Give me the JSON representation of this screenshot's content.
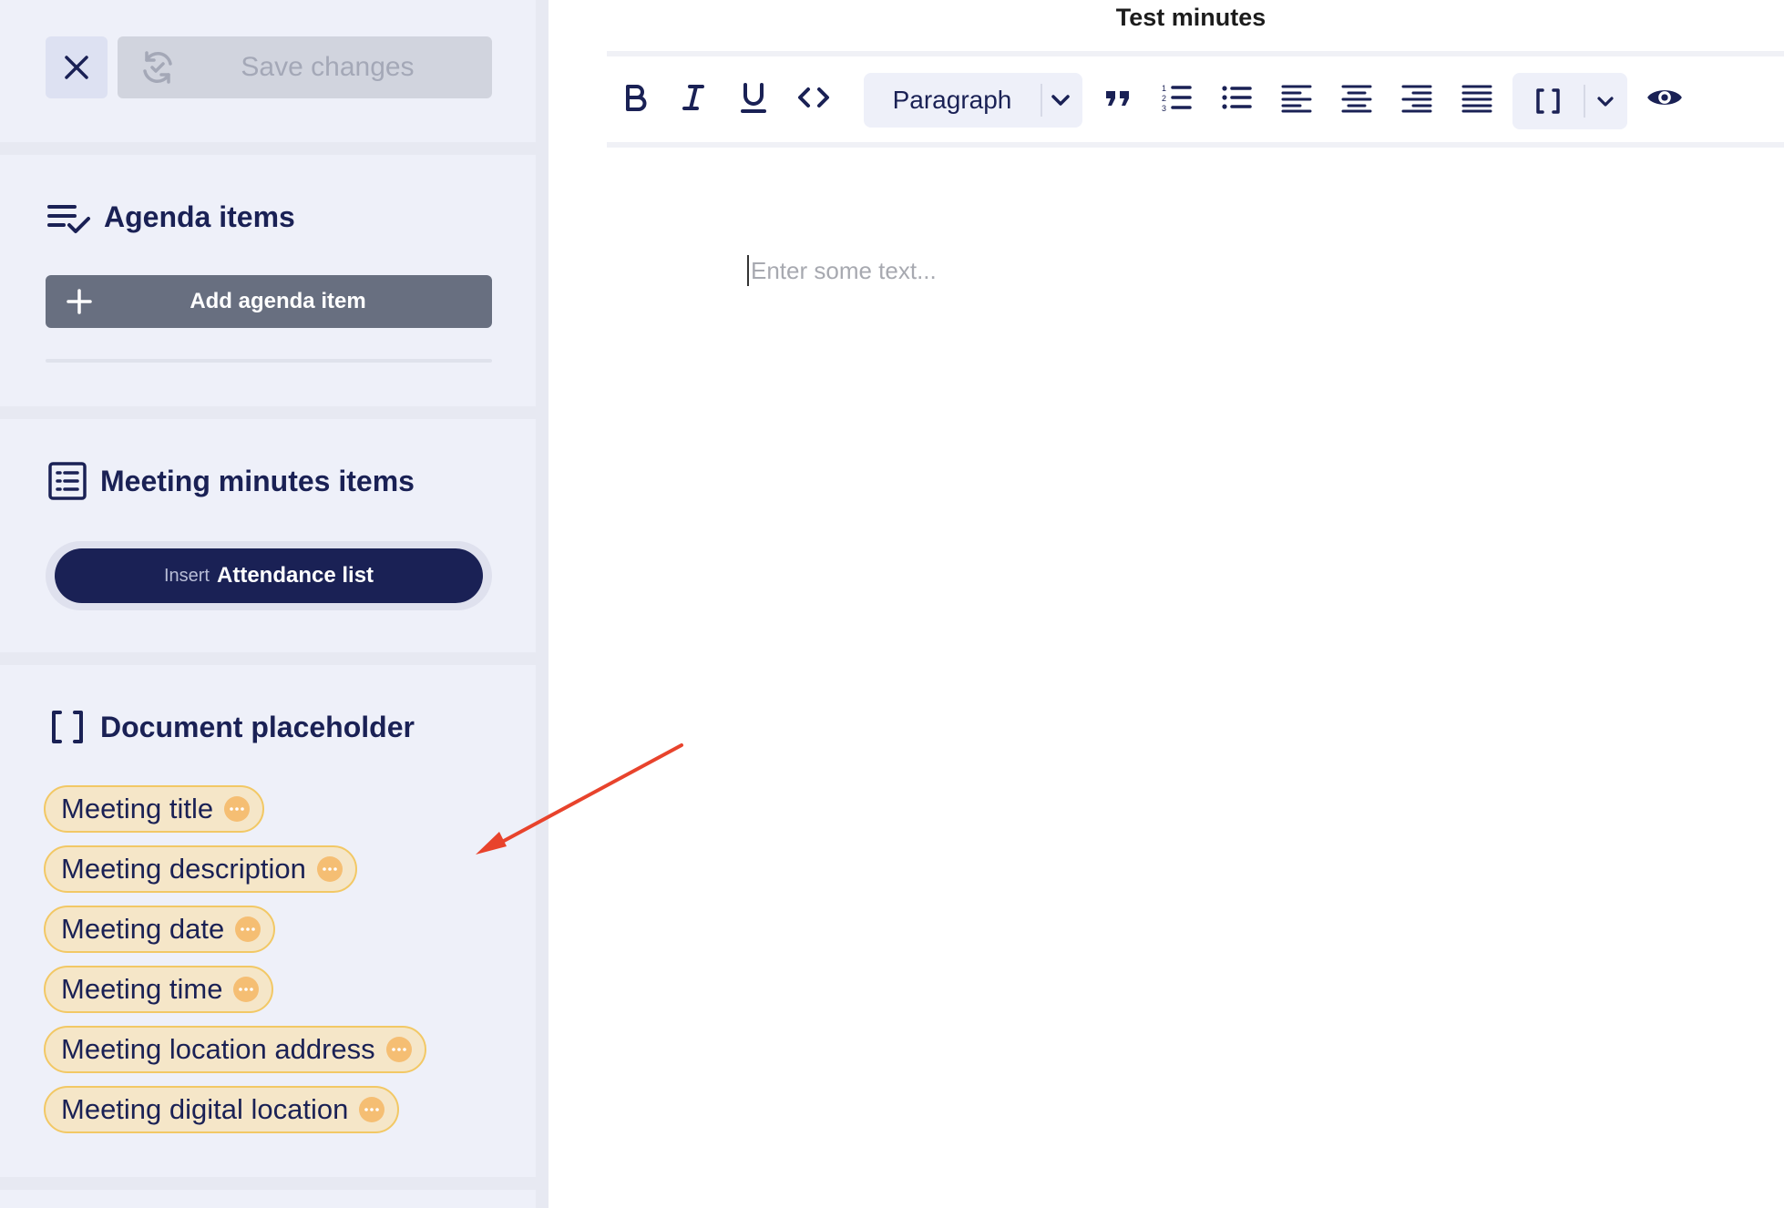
{
  "toolbar_top": {
    "close_icon": "close-icon",
    "sync_icon": "sync-icon",
    "save_label": "Save changes"
  },
  "agenda": {
    "icon": "checklist-icon",
    "heading": "Agenda items",
    "add_label": "Add agenda item"
  },
  "minutes": {
    "icon": "list-box-icon",
    "heading": "Meeting minutes items",
    "insert_prefix": "Insert",
    "insert_label": "Attendance list"
  },
  "placeholders": {
    "icon": "brackets-icon",
    "heading": "Document placeholder",
    "items": [
      {
        "label": "Meeting title"
      },
      {
        "label": "Meeting description"
      },
      {
        "label": "Meeting date"
      },
      {
        "label": "Meeting time"
      },
      {
        "label": "Meeting location address"
      },
      {
        "label": "Meeting digital location"
      }
    ]
  },
  "editor": {
    "title": "Test minutes",
    "block_type": "Paragraph",
    "placeholder": "Enter some text..."
  },
  "colors": {
    "navy": "#1a2155",
    "chip_bg": "#f5e6c8",
    "chip_border": "#f2c865",
    "annotation_arrow": "#e8432c"
  }
}
